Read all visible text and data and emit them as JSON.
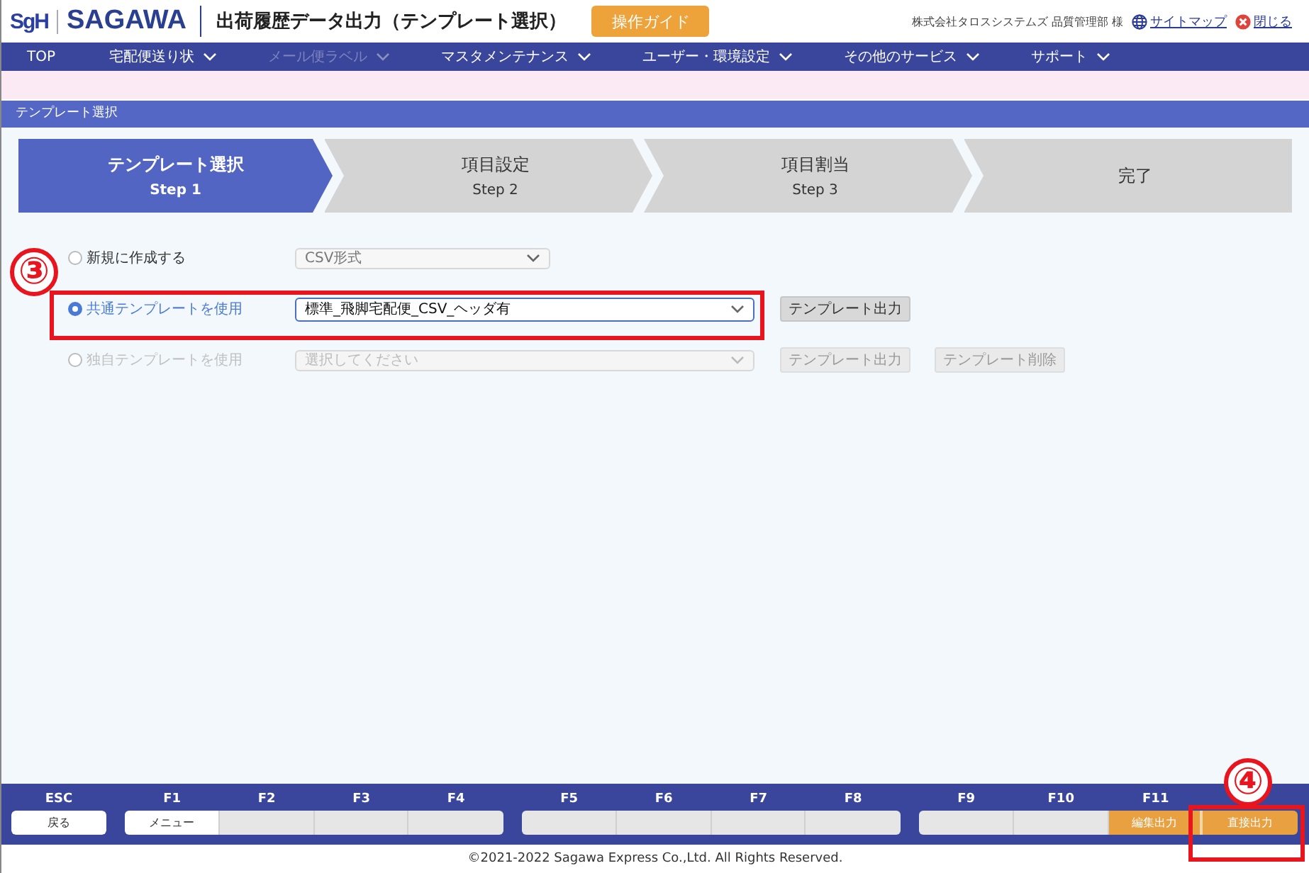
{
  "header": {
    "logo_mark": "SgH",
    "brand": "SAGAWA",
    "title": "出荷履歴データ出力（テンプレート選択）",
    "guide_button": "操作ガイド",
    "user": "株式会社タロスシステムズ 品質管理部 様",
    "links": [
      {
        "kind": "sitemap",
        "label": "サイトマップ"
      },
      {
        "kind": "close",
        "label": "閉じる"
      }
    ]
  },
  "nav": [
    {
      "label": "TOP",
      "has_menu": false,
      "disabled": false
    },
    {
      "label": "宅配便送り状",
      "has_menu": true,
      "disabled": false
    },
    {
      "label": "メール便ラベル",
      "has_menu": true,
      "disabled": true
    },
    {
      "label": "マスタメンテナンス",
      "has_menu": true,
      "disabled": false
    },
    {
      "label": "ユーザー・環境設定",
      "has_menu": true,
      "disabled": false
    },
    {
      "label": "その他のサービス",
      "has_menu": true,
      "disabled": false
    },
    {
      "label": "サポート",
      "has_menu": true,
      "disabled": false
    }
  ],
  "section_title": "テンプレート選択",
  "steps": [
    {
      "title": "テンプレート選択",
      "sub": "Step 1",
      "selected": true
    },
    {
      "title": "項目設定",
      "sub": "Step 2",
      "selected": false
    },
    {
      "title": "項目割当",
      "sub": "Step 3",
      "selected": false
    },
    {
      "title": "完了",
      "selected": false
    }
  ],
  "options": [
    {
      "label": "新規に作成する",
      "selected": false,
      "disabled": false,
      "select": {
        "value": "CSV形式",
        "wide": false
      }
    },
    {
      "label": "共通テンプレートを使用",
      "selected": true,
      "disabled": false,
      "select": {
        "value": "標準_飛脚宅配便_CSV_ヘッダ有",
        "wide": true
      },
      "buttons": [
        {
          "label": "テンプレート出力",
          "disabled": false
        }
      ]
    },
    {
      "label": "独自テンプレートを使用",
      "selected": false,
      "disabled": true,
      "select": {
        "placeholder": "選択してください",
        "wide": true
      },
      "buttons": [
        {
          "label": "テンプレート出力",
          "disabled": true
        },
        {
          "label": "テンプレート削除",
          "disabled": true
        }
      ]
    }
  ],
  "function_keys": [
    [
      {
        "label": "ESC",
        "text": "戻る",
        "kind": "white"
      }
    ],
    [
      {
        "label": "F1",
        "text": "メニュー",
        "kind": "white"
      },
      {
        "label": "F2",
        "kind": "empty"
      },
      {
        "label": "F3",
        "kind": "empty"
      },
      {
        "label": "F4",
        "kind": "empty"
      }
    ],
    [
      {
        "label": "F5",
        "kind": "empty"
      },
      {
        "label": "F6",
        "kind": "empty"
      },
      {
        "label": "F7",
        "kind": "empty"
      },
      {
        "label": "F8",
        "kind": "empty"
      }
    ],
    [
      {
        "label": "F9",
        "kind": "empty"
      },
      {
        "label": "F10",
        "kind": "empty"
      },
      {
        "label": "F11",
        "text": "編集出力",
        "kind": "orange"
      },
      {
        "text": "直接出力",
        "kind": "orange"
      }
    ]
  ],
  "copyright": "©2021-2022 Sagawa Express Co.,Ltd. All Rights Reserved.",
  "annotations": [
    {
      "number": "③"
    },
    {
      "number": "④"
    }
  ]
}
